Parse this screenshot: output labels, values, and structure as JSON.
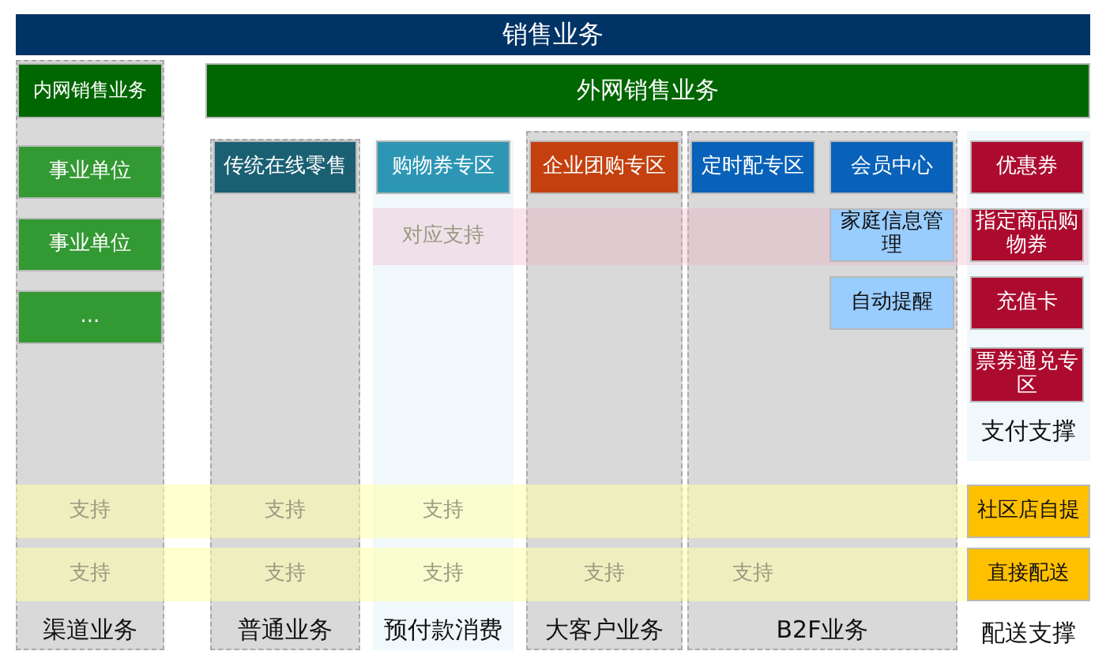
{
  "title": "销售业务",
  "intranet": {
    "header": "内网销售业务",
    "units": [
      "事业单位",
      "事业单位",
      "..."
    ],
    "label": "渠道业务"
  },
  "extranet": {
    "header": "外网销售业务"
  },
  "columns": [
    {
      "label": "普通业务",
      "kind": "gray",
      "stacks": [
        [
          {
            "text": "传统在线零售",
            "color": "#1b5f73"
          }
        ]
      ]
    },
    {
      "label": "预付款消费",
      "kind": "light",
      "stacks": [
        [
          {
            "text": "购物券专区",
            "color": "#2e96b5"
          }
        ]
      ]
    },
    {
      "label": "大客户业务",
      "kind": "gray",
      "stacks": [
        [
          {
            "text": "企业团购专区",
            "color": "#c4410f"
          }
        ]
      ]
    },
    {
      "label": "B2F业务",
      "kind": "gray",
      "stacks": [
        [
          {
            "text": "定时配专区",
            "color": "#0962b9"
          }
        ],
        [
          {
            "text": "会员中心",
            "color": "#0962b9"
          },
          {
            "text": "家庭信息管理",
            "color": "#99ccff"
          },
          {
            "text": "自动提醒",
            "color": "#99ccff"
          }
        ]
      ]
    }
  ],
  "mapping_band": {
    "text": "对应支持"
  },
  "payment": {
    "label": "支付支撑",
    "items": [
      "优惠券",
      "指定商品购物券",
      "充值卡",
      "票券通兑专区"
    ]
  },
  "support_bands": [
    {
      "texts": [
        "支持",
        "支持",
        "支持"
      ],
      "delivery": "社区店自提"
    },
    {
      "texts": [
        "支持",
        "支持",
        "支持",
        "支持",
        "支持"
      ],
      "delivery": "直接配送"
    }
  ],
  "delivery_label": "配送支撑"
}
